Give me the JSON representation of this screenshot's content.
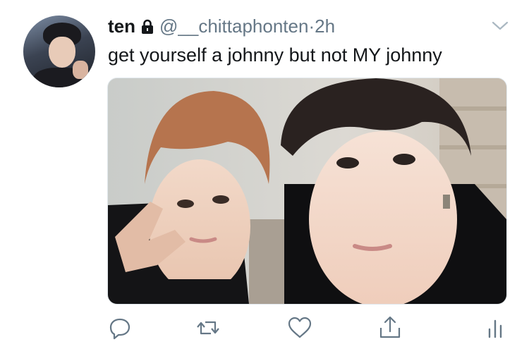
{
  "tweet": {
    "display_name": "ten",
    "handle": "@__chittaphonten",
    "separator": "·",
    "time": "2h",
    "text": "get yourself a johnny but not MY johnny",
    "protected": true
  },
  "icons": {
    "lock": "lock-icon",
    "caret": "chevron-down-icon",
    "reply": "reply-icon",
    "retweet": "retweet-icon",
    "like": "heart-icon",
    "share": "share-icon",
    "analytics": "analytics-icon"
  },
  "colors": {
    "text_primary": "#14171a",
    "text_secondary": "#657786",
    "icon": "#657786"
  }
}
